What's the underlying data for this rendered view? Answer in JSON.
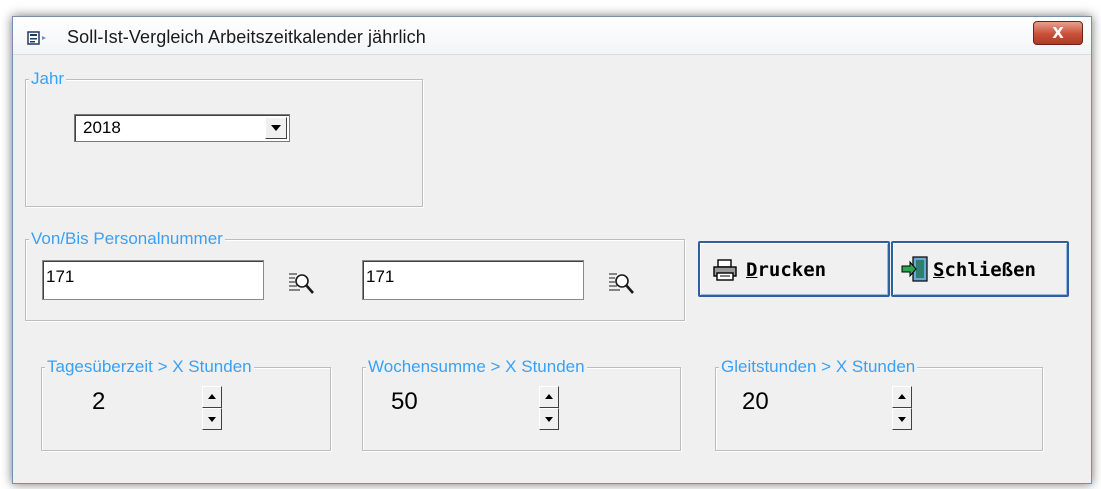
{
  "window": {
    "title": "Soll-Ist-Vergleich Arbeitszeitkalender jährlich",
    "close_symbol": "X",
    "icon": "form-window-icon"
  },
  "year_group": {
    "legend": "Jahr",
    "selected": "2018"
  },
  "personnel_group": {
    "legend": "Von/Bis  Personalnummer",
    "from_value": "171",
    "to_value": "171",
    "lookup_icon": "magnifier-icon"
  },
  "buttons": {
    "print_label": "Drucken",
    "print_icon": "printer-icon",
    "close_label": "Schließen",
    "close_icon": "exit-door-icon"
  },
  "thresholds": [
    {
      "legend": "Tagesüberzeit > X Stunden",
      "value": "2"
    },
    {
      "legend": "Wochensumme > X Stunden",
      "value": "50"
    },
    {
      "legend": "Gleitstunden > X Stunden",
      "value": "20"
    }
  ],
  "colors": {
    "legend_text": "#3aa0f5",
    "button_border": "#2e5f9e",
    "window_bg": "#f0f0f0"
  }
}
